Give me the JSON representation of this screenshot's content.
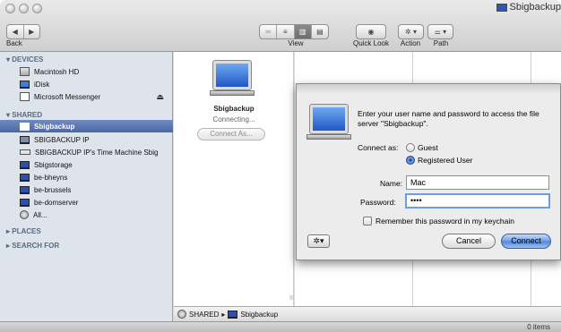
{
  "window": {
    "title": "Sbigbackup"
  },
  "toolbar": {
    "back_label": "Back",
    "view_label": "View",
    "quicklook_label": "Quick Look",
    "action_label": "Action",
    "path_label": "Path"
  },
  "sidebar": {
    "devices_header": "DEVICES",
    "devices": [
      "Macintosh HD",
      "iDisk",
      "Microsoft Messenger"
    ],
    "shared_header": "SHARED",
    "shared": [
      "Sbigbackup",
      "SBIGBACKUP IP",
      "SBIGBACKUP IP's Time Machine Sbig",
      "Sbigstorage",
      "be-bheyns",
      "be-brussels",
      "be-domserver",
      "All..."
    ],
    "places_header": "PLACES",
    "search_header": "SEARCH FOR"
  },
  "server": {
    "name": "Sbigbackup",
    "status": "Connecting...",
    "connect_as_label": "Connect As..."
  },
  "pathbar": {
    "root": "SHARED",
    "sep": "▸",
    "current": "Sbigbackup"
  },
  "status": {
    "items": "0 items"
  },
  "dialog": {
    "message": "Enter your user name and password to access the file server \"Sbigbackup\".",
    "connect_as_label": "Connect as:",
    "guest_label": "Guest",
    "registered_label": "Registered User",
    "selected_option": "Registered User",
    "name_label": "Name:",
    "name_value": "Mac",
    "password_label": "Password:",
    "password_value": "••••",
    "remember_label": "Remember this password in my keychain",
    "remember_checked": false,
    "cancel_label": "Cancel",
    "connect_label": "Connect"
  },
  "colors": {
    "selection": "#4b67a3",
    "default_button": "#4f85d6",
    "focus_ring": "#6d9de0"
  }
}
